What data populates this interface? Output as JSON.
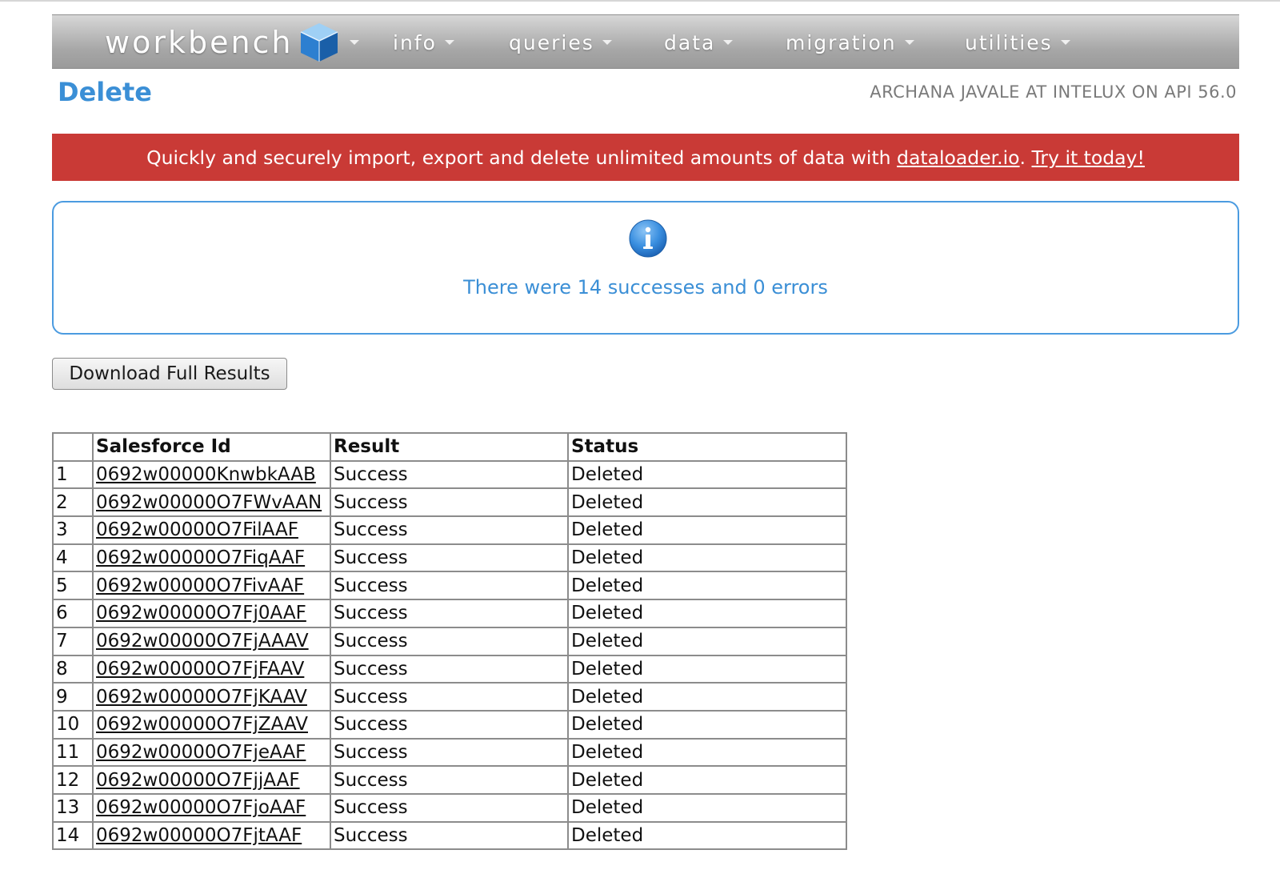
{
  "nav": {
    "brand": "workbench",
    "items": [
      {
        "label": "info"
      },
      {
        "label": "queries"
      },
      {
        "label": "data"
      },
      {
        "label": "migration"
      },
      {
        "label": "utilities"
      }
    ]
  },
  "header": {
    "title": "Delete",
    "user_info": "ARCHANA JAVALE AT INTELUX ON API 56.0"
  },
  "promo": {
    "text_before": "Quickly and securely import, export and delete unlimited amounts of data with ",
    "link": "dataloader.io",
    "separator": ". ",
    "cta": "Try it today!"
  },
  "info": {
    "icon": "info-icon",
    "message": "There were 14 successes and 0 errors"
  },
  "download_button": "Download Full Results",
  "table": {
    "headers": [
      "",
      "Salesforce Id",
      "Result",
      "Status"
    ],
    "rows": [
      {
        "num": "1",
        "id": "0692w00000KnwbkAAB",
        "result": "Success",
        "status": "Deleted"
      },
      {
        "num": "2",
        "id": "0692w00000O7FWvAAN",
        "result": "Success",
        "status": "Deleted"
      },
      {
        "num": "3",
        "id": "0692w00000O7FilAAF",
        "result": "Success",
        "status": "Deleted"
      },
      {
        "num": "4",
        "id": "0692w00000O7FiqAAF",
        "result": "Success",
        "status": "Deleted"
      },
      {
        "num": "5",
        "id": "0692w00000O7FivAAF",
        "result": "Success",
        "status": "Deleted"
      },
      {
        "num": "6",
        "id": "0692w00000O7Fj0AAF",
        "result": "Success",
        "status": "Deleted"
      },
      {
        "num": "7",
        "id": "0692w00000O7FjAAAV",
        "result": "Success",
        "status": "Deleted"
      },
      {
        "num": "8",
        "id": "0692w00000O7FjFAAV",
        "result": "Success",
        "status": "Deleted"
      },
      {
        "num": "9",
        "id": "0692w00000O7FjKAAV",
        "result": "Success",
        "status": "Deleted"
      },
      {
        "num": "10",
        "id": "0692w00000O7FjZAAV",
        "result": "Success",
        "status": "Deleted"
      },
      {
        "num": "11",
        "id": "0692w00000O7FjeAAF",
        "result": "Success",
        "status": "Deleted"
      },
      {
        "num": "12",
        "id": "0692w00000O7FjjAAF",
        "result": "Success",
        "status": "Deleted"
      },
      {
        "num": "13",
        "id": "0692w00000O7FjoAAF",
        "result": "Success",
        "status": "Deleted"
      },
      {
        "num": "14",
        "id": "0692w00000O7FjtAAF",
        "result": "Success",
        "status": "Deleted"
      }
    ]
  },
  "colors": {
    "accent": "#3b8fd6",
    "promo_bg": "#c93a36",
    "info_border": "#4b9be0"
  }
}
